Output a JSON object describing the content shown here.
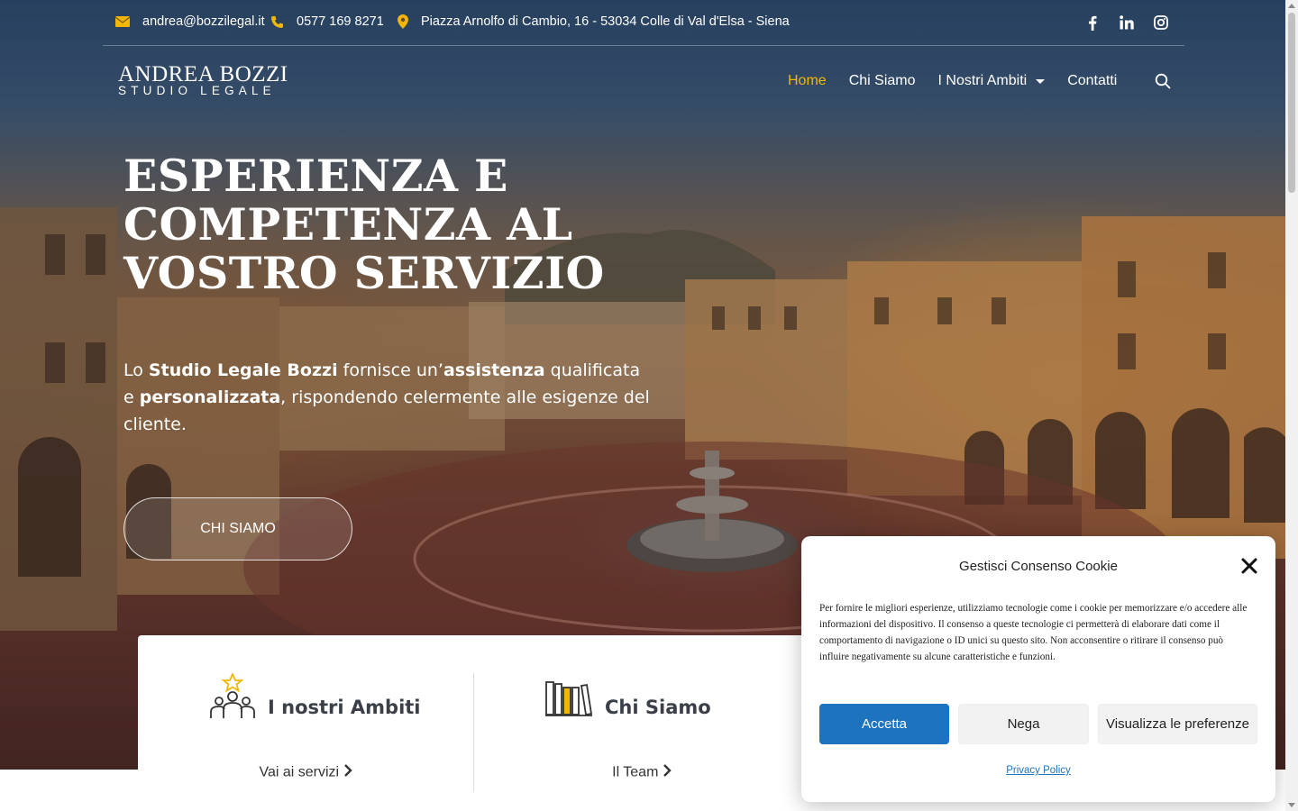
{
  "topbar": {
    "email": "andrea@bozzilegal.it",
    "phone": "0577 169 8271",
    "address": "Piazza Arnolfo di Cambio, 16 - 53034 Colle di Val d'Elsa - Siena",
    "socials": [
      "facebook-icon",
      "linkedin-icon",
      "instagram-icon"
    ]
  },
  "logo": {
    "line1": "ANDREA BOZZI",
    "line2": "STUDIO LEGALE"
  },
  "nav": {
    "items": [
      {
        "label": "Home"
      },
      {
        "label": "Chi Siamo"
      },
      {
        "label": "I Nostri Ambiti"
      },
      {
        "label": "Contatti"
      }
    ]
  },
  "hero": {
    "headline": "ESPERIENZA E COMPETENZA AL VOSTRO SERVIZIO",
    "lead": {
      "p1": "Lo ",
      "b1": "Studio Legale Bozzi",
      "p2": " fornisce un’",
      "b2": "assistenza",
      "p3": " qualificata e ",
      "b3": "personalizzata",
      "p4": ", rispondendo celermente alle esigenze del cliente."
    },
    "cta": "CHI SIAMO"
  },
  "cards": [
    {
      "title": "I nostri Ambiti",
      "link": "Vai ai servizi"
    },
    {
      "title": "Chi Siamo",
      "link": "Il Team"
    }
  ],
  "cookie": {
    "title": "Gestisci Consenso Cookie",
    "text": "Per fornire le migliori esperienze, utilizziamo tecnologie come i cookie per memorizzare e/o accedere alle informazioni del dispositivo. Il consenso a queste tecnologie ci permetterà di elaborare dati come il comportamento di navigazione o ID unici su questo sito. Non acconsentire o ritirare il consenso può influire negativamente su alcune caratteristiche e funzioni.",
    "accept": "Accetta",
    "deny": "Nega",
    "prefs": "Visualizza le preferenze",
    "privacy": "Privacy Policy"
  },
  "colors": {
    "accent": "#f2b705",
    "button_blue": "#1e73be"
  }
}
